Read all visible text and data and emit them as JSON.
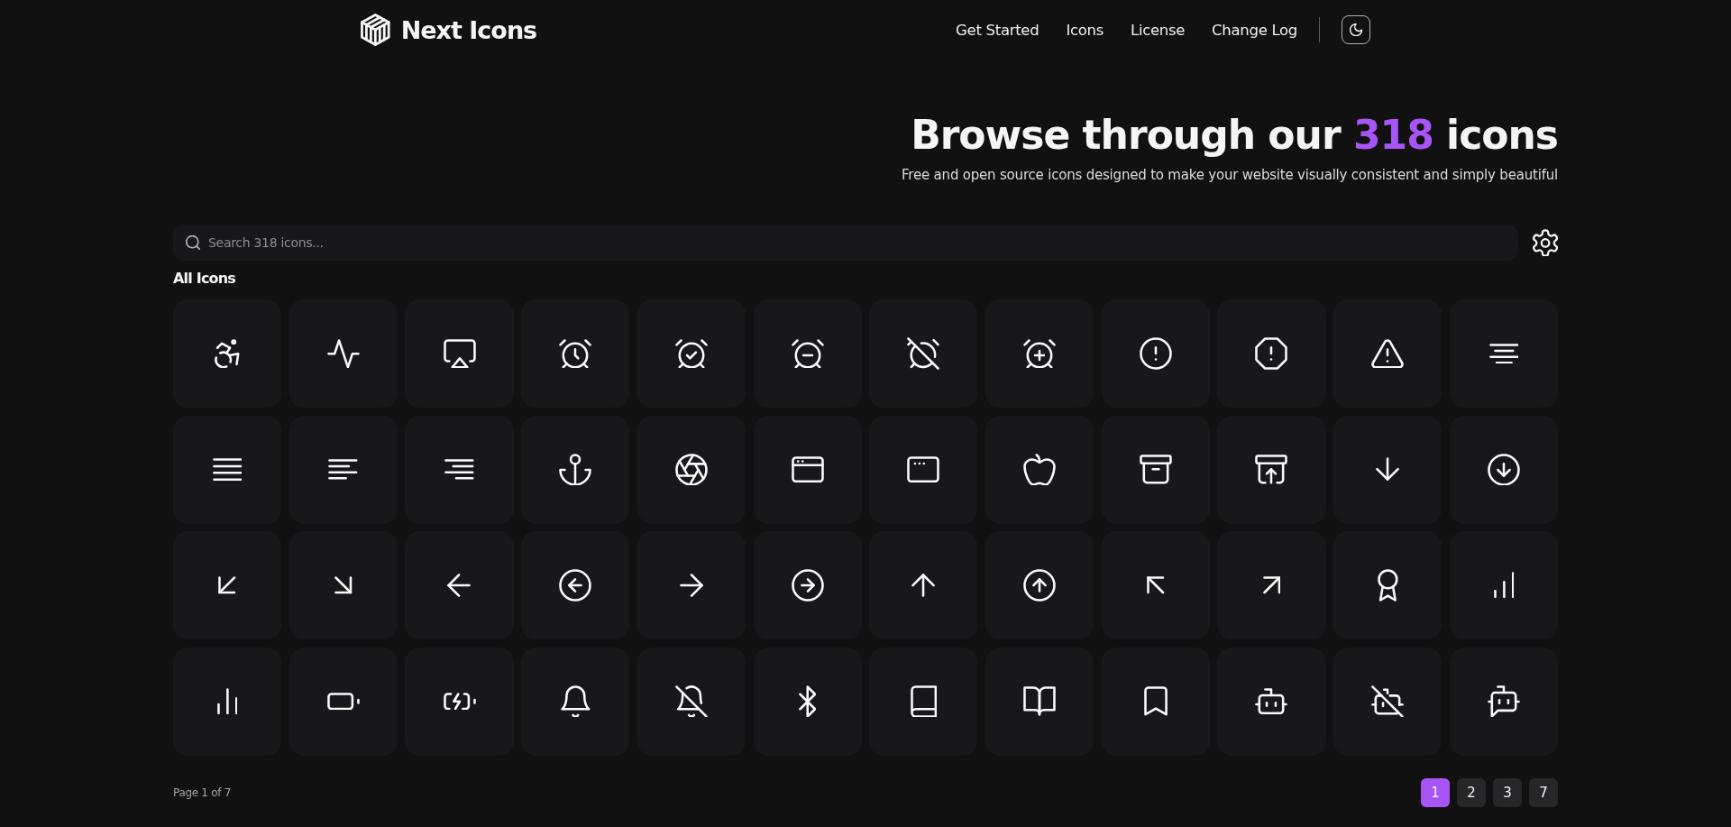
{
  "header": {
    "brand": "Next Icons",
    "nav": [
      "Get Started",
      "Icons",
      "License",
      "Change Log"
    ]
  },
  "hero": {
    "title": {
      "lead": "Browse through our",
      "count": "318",
      "tail": "icons"
    },
    "subtitle": "Free and open source icons designed to make your website visually consistent and simply beautiful"
  },
  "search": {
    "placeholder": "Search 318 icons..."
  },
  "section": {
    "title": "All Icons"
  },
  "pagination": {
    "summary": "Page 1 of 7",
    "pages": [
      {
        "label": "1",
        "selected": true
      },
      {
        "label": "2",
        "selected": false
      },
      {
        "label": "3",
        "selected": false
      },
      {
        "label": "7",
        "selected": false
      }
    ]
  }
}
